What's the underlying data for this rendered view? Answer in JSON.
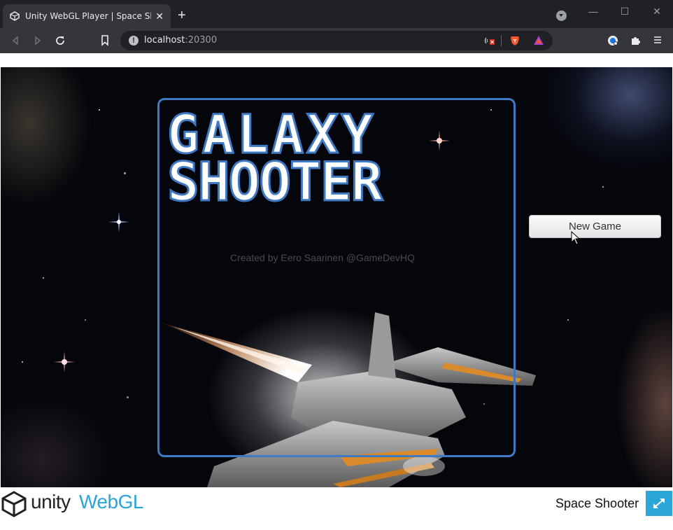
{
  "browser": {
    "tab_title": "Unity WebGL Player | Space Shooter",
    "new_tab_symbol": "+",
    "close_symbol": "✕",
    "url_host": "localhost",
    "url_port": ":20300",
    "info_symbol": "!",
    "window_controls": {
      "minimize": "—",
      "maximize": "☐",
      "close": "✕"
    }
  },
  "game": {
    "title_line1": "GALAXY",
    "title_line2": "SHOOTER",
    "credit": "Created by Eero Saarinen @GameDevHQ",
    "new_game_label": "New Game",
    "frame_color": "#3f79c4"
  },
  "footer": {
    "unity_label": "unity",
    "webgl_label": "WebGL",
    "game_title": "Space Shooter",
    "accent_color": "#29a4d9"
  },
  "icons": [
    "unity-tab-icon",
    "close-icon",
    "plus-icon",
    "tab-search-icon",
    "minimize-icon",
    "maximize-icon",
    "window-close-icon",
    "back-icon",
    "forward-icon",
    "reload-icon",
    "bookmark-icon",
    "info-icon",
    "cast-blocked-icon",
    "brave-shield-icon",
    "brave-rewards-icon",
    "account-icon",
    "extensions-icon",
    "menu-icon",
    "unity-logo-icon",
    "fullscreen-icon",
    "cursor-icon"
  ]
}
